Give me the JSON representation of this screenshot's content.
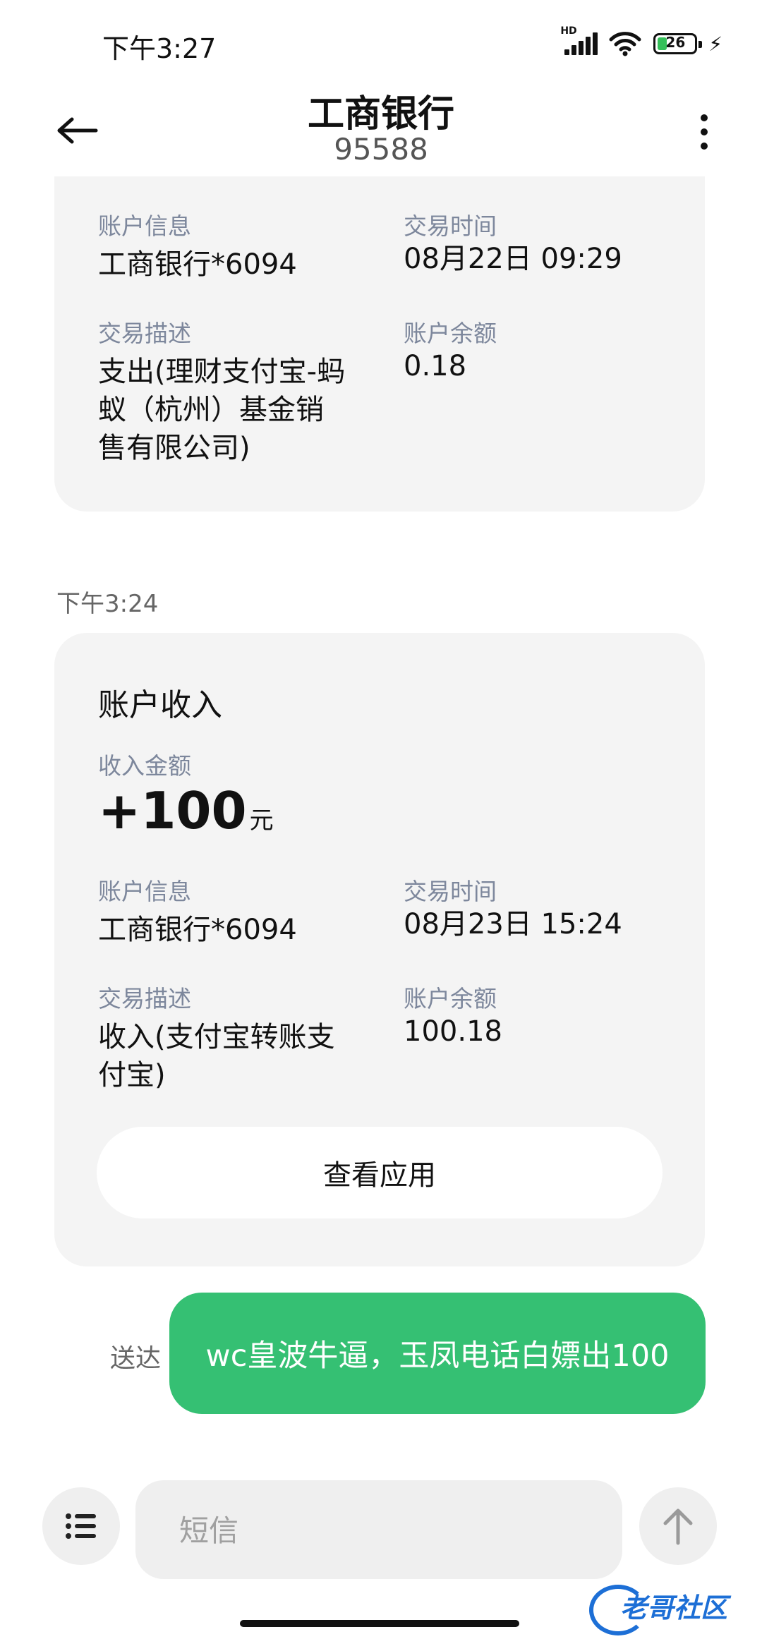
{
  "status_bar": {
    "time": "下午3:27",
    "signal_label": "HD",
    "battery": "26",
    "battery_fill_percent": 26,
    "icons": [
      "signal-icon",
      "wifi-icon",
      "battery-icon",
      "charging-icon"
    ]
  },
  "header": {
    "title": "工商银行",
    "subtitle": "95588",
    "back_icon": "back-arrow-icon",
    "more_icon": "more-vertical-icon"
  },
  "prev_message": {
    "account_label": "账户信息",
    "account_value": "工商银行*6094",
    "time_label": "交易时间",
    "time_value": "08月22日 09:29",
    "desc_label": "交易描述",
    "desc_lines": [
      "支出(理财支付宝-蚂",
      "蚁（杭州）基金销",
      "售有限公司)"
    ],
    "balance_label": "账户余额",
    "balance_value": "0.18"
  },
  "message": {
    "timestamp": "下午3:24",
    "title": "账户收入",
    "amount_label": "收入金额",
    "amount_value": "+100",
    "amount_unit": "元",
    "account_label": "账户信息",
    "account_value": "工商银行*6094",
    "time_label": "交易时间",
    "time_value": "08月23日 15:24",
    "desc_label": "交易描述",
    "desc_lines": [
      "收入(支付宝转账支",
      "付宝)"
    ],
    "balance_label": "账户余额",
    "balance_value": "100.18",
    "view_app_button": "查看应用"
  },
  "sent_message": {
    "status": "送达",
    "text": "wc皇波牛逼，玉凤电话白嫖出100"
  },
  "compose": {
    "placeholder": "短信",
    "menu_icon": "list-icon",
    "send_icon": "send-arrow-up-icon"
  },
  "watermark": {
    "text": "老哥社区"
  },
  "colors": {
    "bubble_green": "#35c073",
    "label_gray": "#7d879c",
    "card_bg": "#f4f4f4",
    "battery_green": "#35c05a",
    "watermark_blue": "#1d6fd6"
  }
}
